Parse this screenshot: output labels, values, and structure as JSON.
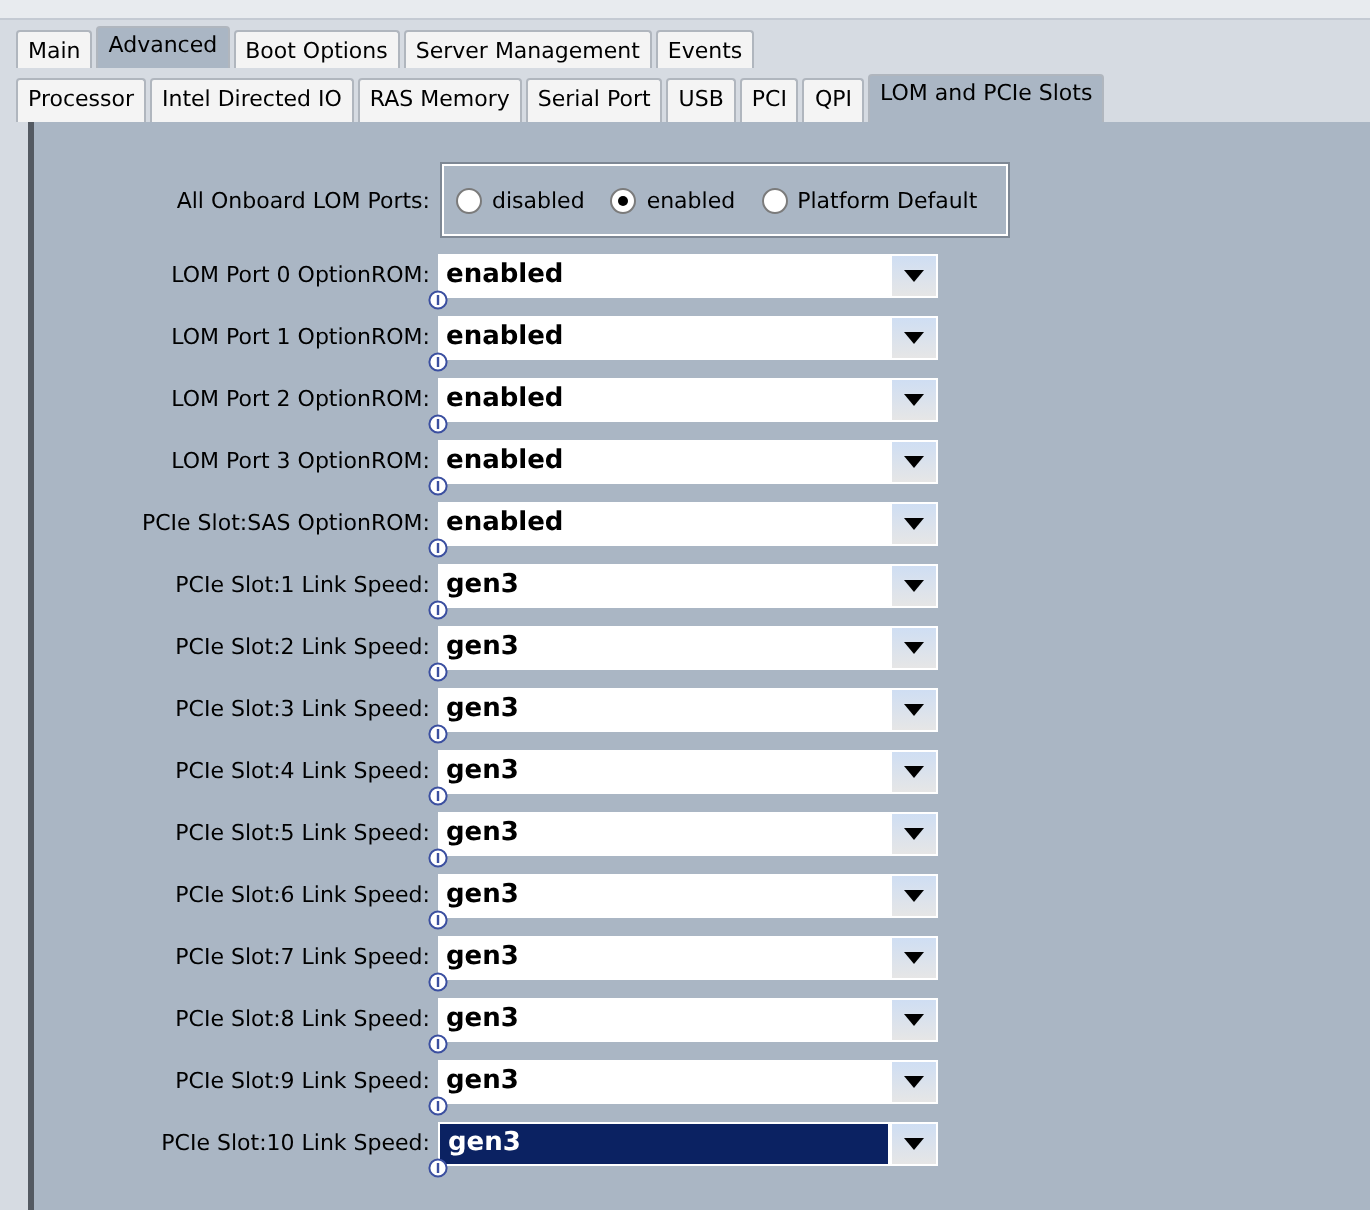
{
  "tabs": [
    {
      "label": "Main",
      "selected": false
    },
    {
      "label": "Advanced",
      "selected": true
    },
    {
      "label": "Boot Options",
      "selected": false
    },
    {
      "label": "Server Management",
      "selected": false
    },
    {
      "label": "Events",
      "selected": false
    }
  ],
  "subtabs": [
    {
      "label": "Processor",
      "selected": false
    },
    {
      "label": "Intel Directed IO",
      "selected": false
    },
    {
      "label": "RAS Memory",
      "selected": false
    },
    {
      "label": "Serial Port",
      "selected": false
    },
    {
      "label": "USB",
      "selected": false
    },
    {
      "label": "PCI",
      "selected": false
    },
    {
      "label": "QPI",
      "selected": false
    },
    {
      "label": "LOM and PCIe Slots",
      "selected": true
    }
  ],
  "radio_setting": {
    "label": "All Onboard LOM Ports:",
    "options": [
      {
        "label": "disabled",
        "selected": false
      },
      {
        "label": "enabled",
        "selected": true
      },
      {
        "label": "Platform Default",
        "selected": false
      }
    ]
  },
  "settings": [
    {
      "label": "LOM Port 0 OptionROM:",
      "value": "enabled",
      "selected": false
    },
    {
      "label": "LOM Port 1 OptionROM:",
      "value": "enabled",
      "selected": false
    },
    {
      "label": "LOM Port 2 OptionROM:",
      "value": "enabled",
      "selected": false
    },
    {
      "label": "LOM Port 3 OptionROM:",
      "value": "enabled",
      "selected": false
    },
    {
      "label": "PCIe Slot:SAS OptionROM:",
      "value": "enabled",
      "selected": false
    },
    {
      "label": "PCIe Slot:1 Link Speed:",
      "value": "gen3",
      "selected": false
    },
    {
      "label": "PCIe Slot:2 Link Speed:",
      "value": "gen3",
      "selected": false
    },
    {
      "label": "PCIe Slot:3 Link Speed:",
      "value": "gen3",
      "selected": false
    },
    {
      "label": "PCIe Slot:4 Link Speed:",
      "value": "gen3",
      "selected": false
    },
    {
      "label": "PCIe Slot:5 Link Speed:",
      "value": "gen3",
      "selected": false
    },
    {
      "label": "PCIe Slot:6 Link Speed:",
      "value": "gen3",
      "selected": false
    },
    {
      "label": "PCIe Slot:7 Link Speed:",
      "value": "gen3",
      "selected": false
    },
    {
      "label": "PCIe Slot:8 Link Speed:",
      "value": "gen3",
      "selected": false
    },
    {
      "label": "PCIe Slot:9 Link Speed:",
      "value": "gen3",
      "selected": false
    },
    {
      "label": "PCIe Slot:10 Link Speed:",
      "value": "gen3",
      "selected": true
    }
  ]
}
